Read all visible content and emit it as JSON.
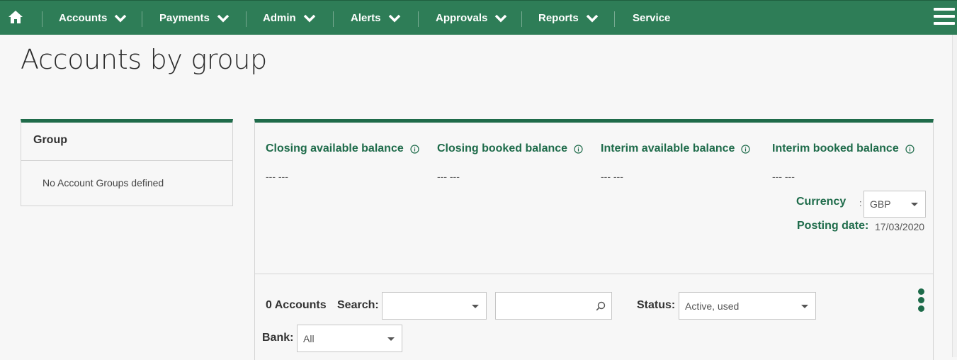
{
  "nav": {
    "items": [
      {
        "label": "Accounts"
      },
      {
        "label": "Payments"
      },
      {
        "label": "Admin"
      },
      {
        "label": "Alerts"
      },
      {
        "label": "Approvals"
      },
      {
        "label": "Reports"
      },
      {
        "label": "Service"
      }
    ]
  },
  "page": {
    "title": "Accounts by group"
  },
  "group_panel": {
    "header": "Group",
    "empty_text": "No Account Groups defined"
  },
  "balances": [
    {
      "label": "Closing available balance",
      "value": "--- ---"
    },
    {
      "label": "Closing booked balance",
      "value": "--- ---"
    },
    {
      "label": "Interim available balance",
      "value": "--- ---"
    },
    {
      "label": "Interim booked balance",
      "value": "--- ---"
    }
  ],
  "currency": {
    "label": "Currency",
    "separator": ":",
    "selected": "GBP"
  },
  "posting_date": {
    "label": "Posting date:",
    "value": "17/03/2020"
  },
  "toolbar": {
    "account_count": "0 Accounts",
    "search_label": "Search:",
    "search_field_selected": "",
    "search_text": "",
    "status_label": "Status:",
    "status_selected": "Active, used",
    "bank_label": "Bank:",
    "bank_selected": "All"
  },
  "colors": {
    "nav_bg": "#2e7d57",
    "accent": "#1e6b4a",
    "panel_border_top": "#1f6b4a"
  }
}
